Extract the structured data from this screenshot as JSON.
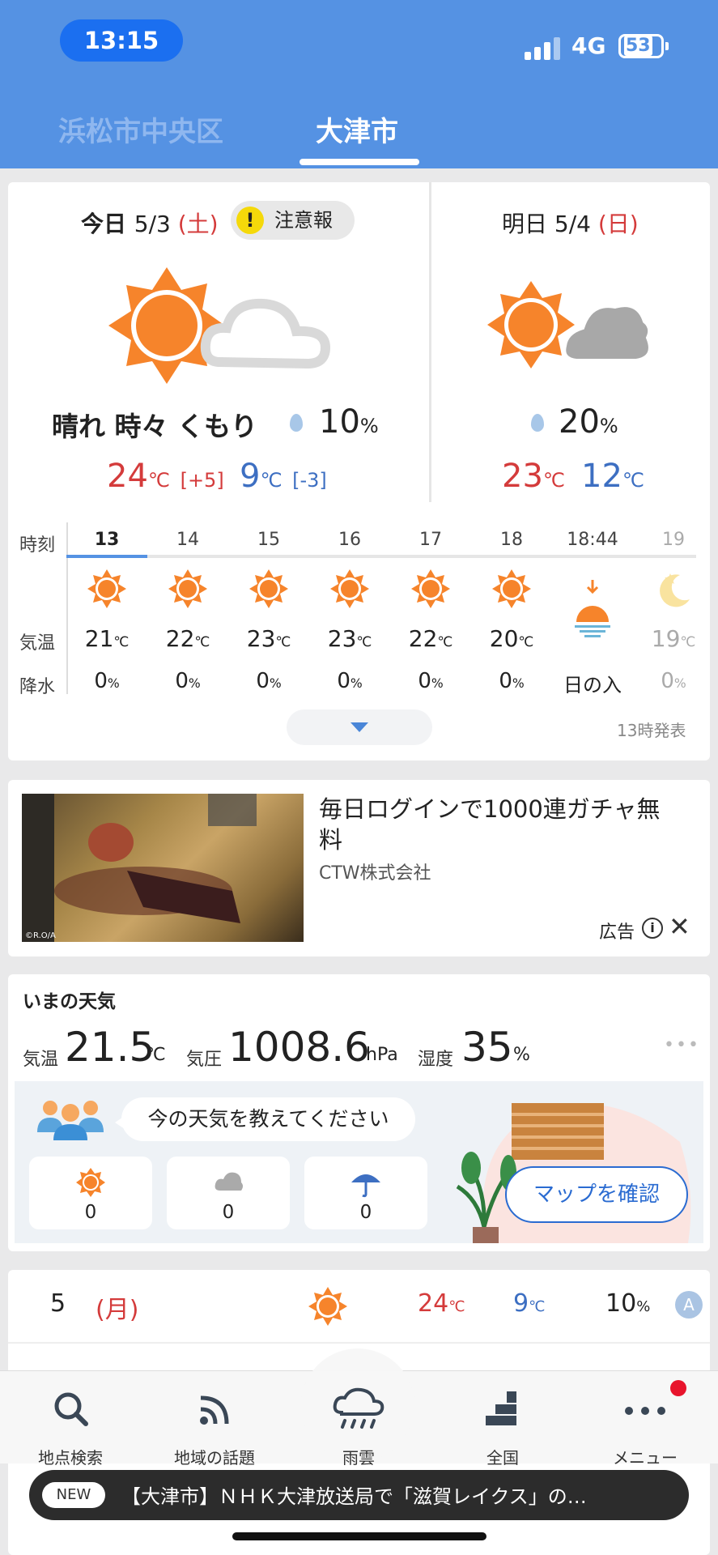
{
  "status": {
    "time": "13:15",
    "network": "4G",
    "battery": "53"
  },
  "location_tabs": [
    {
      "label": "浜松市中央区",
      "active": false
    },
    {
      "label": "大津市",
      "active": true
    }
  ],
  "today": {
    "prefix": "今日 ",
    "date": "5/3",
    "weekday": "(土)",
    "warning": "注意報",
    "warning_mark": "!",
    "condition": "晴れ 時々 くもり",
    "pop": "10",
    "pop_unit": "%",
    "high": "24",
    "high_unit": "℃",
    "high_diff": "[+5]",
    "low": "9",
    "low_unit": "℃",
    "low_diff": "[-3]"
  },
  "tomorrow": {
    "prefix": "明日 ",
    "date": "5/4",
    "weekday": "(日)",
    "pop": "20",
    "pop_unit": "%",
    "high": "23",
    "high_unit": "℃",
    "low": "12",
    "low_unit": "℃"
  },
  "hourly": {
    "labels": {
      "time": "時刻",
      "temp": "気温",
      "rain": "降水"
    },
    "temp_unit": "℃",
    "rain_unit": "%",
    "columns": [
      {
        "time": "13",
        "icon": "sun-icon",
        "temp": "21",
        "rain": "0"
      },
      {
        "time": "14",
        "icon": "sun-icon",
        "temp": "22",
        "rain": "0"
      },
      {
        "time": "15",
        "icon": "sun-icon",
        "temp": "23",
        "rain": "0"
      },
      {
        "time": "16",
        "icon": "sun-icon",
        "temp": "23",
        "rain": "0"
      },
      {
        "time": "17",
        "icon": "sun-icon",
        "temp": "22",
        "rain": "0"
      },
      {
        "time": "18",
        "icon": "sun-icon",
        "temp": "20",
        "rain": "0"
      },
      {
        "time": "18:44",
        "icon": "sunset-icon",
        "temp": "",
        "rain": "日の入"
      },
      {
        "time": "19",
        "icon": "moon-icon",
        "temp": "19",
        "rain": "0"
      }
    ],
    "published": "13時発表"
  },
  "ad": {
    "title": "毎日ログインで1000連ガチャ無料",
    "company": "CTW株式会社",
    "label": "広告",
    "info_mark": "i",
    "close_mark": "✕",
    "image_credit": "©R.O/A"
  },
  "now": {
    "title": "いまの天気",
    "temp_label": "気温",
    "temp": "21.5",
    "temp_unit": "℃",
    "pressure_label": "気圧",
    "pressure": "1008.6",
    "pressure_unit": "hPa",
    "humidity_label": "湿度",
    "humidity": "35",
    "humidity_unit": "%",
    "more": "•••",
    "survey_prompt": "今の天気を教えてください",
    "survey_counts": {
      "sunny": "0",
      "cloudy": "0",
      "rainy": "0"
    },
    "map_button": "マップを確認"
  },
  "weekly": [
    {
      "day": "5",
      "weekday": "(月)",
      "icon": "sun-icon",
      "high": "24",
      "low": "9",
      "pop": "10",
      "badge": "A"
    }
  ],
  "weekly_units": {
    "temp": "℃",
    "pop": "%"
  },
  "tabbar": [
    {
      "label": "地点検索",
      "icon": "search-icon"
    },
    {
      "label": "地域の話題",
      "icon": "rss-icon"
    },
    {
      "label": "雨雲",
      "icon": "rain-cloud-icon"
    },
    {
      "label": "全国",
      "icon": "map-blocks-icon"
    },
    {
      "label": "メニュー",
      "icon": "dots-icon"
    }
  ],
  "news": {
    "tag": "NEW",
    "text": "【大津市】ＮＨＫ大津放送局で「滋賀レイクス」の…"
  },
  "colors": {
    "header": "#5592e3",
    "sun": "#f6842b",
    "high": "#d43b3b",
    "low": "#3d6fc2"
  }
}
